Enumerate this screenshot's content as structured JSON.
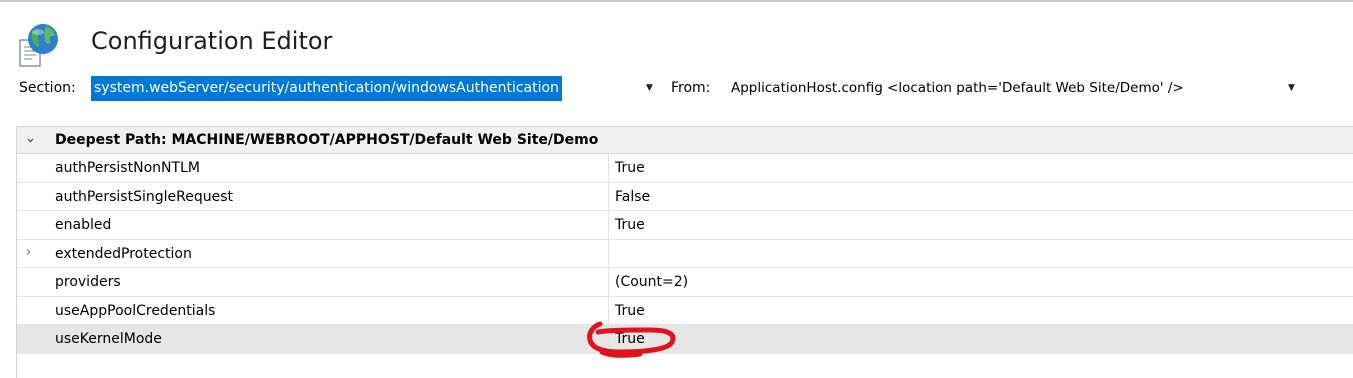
{
  "title": "Configuration Editor",
  "section": {
    "label": "Section:",
    "value": "system.webServer/security/authentication/windowsAuthentication",
    "arrow_icon": "dropdown-arrow-icon"
  },
  "from": {
    "label": "From:",
    "value": "ApplicationHost.config <location path='Default Web Site/Demo' />",
    "arrow_icon": "dropdown-arrow-icon"
  },
  "grid": {
    "group_title": "Deepest Path: MACHINE/WEBROOT/APPHOST/Default Web Site/Demo",
    "group_expanded": true,
    "rows": [
      {
        "name": "authPersistNonNTLM",
        "value": "True",
        "expandable": false,
        "selected": false
      },
      {
        "name": "authPersistSingleRequest",
        "value": "False",
        "expandable": false,
        "selected": false
      },
      {
        "name": "enabled",
        "value": "True",
        "expandable": false,
        "selected": false
      },
      {
        "name": "extendedProtection",
        "value": "",
        "expandable": true,
        "selected": false
      },
      {
        "name": "providers",
        "value": "(Count=2)",
        "expandable": false,
        "selected": false
      },
      {
        "name": "useAppPoolCredentials",
        "value": "True",
        "expandable": false,
        "selected": false
      },
      {
        "name": "useKernelMode",
        "value": "True",
        "expandable": false,
        "selected": true
      }
    ]
  },
  "colors": {
    "selection_highlight": "#0078d7",
    "annotation": "#e0121b"
  }
}
